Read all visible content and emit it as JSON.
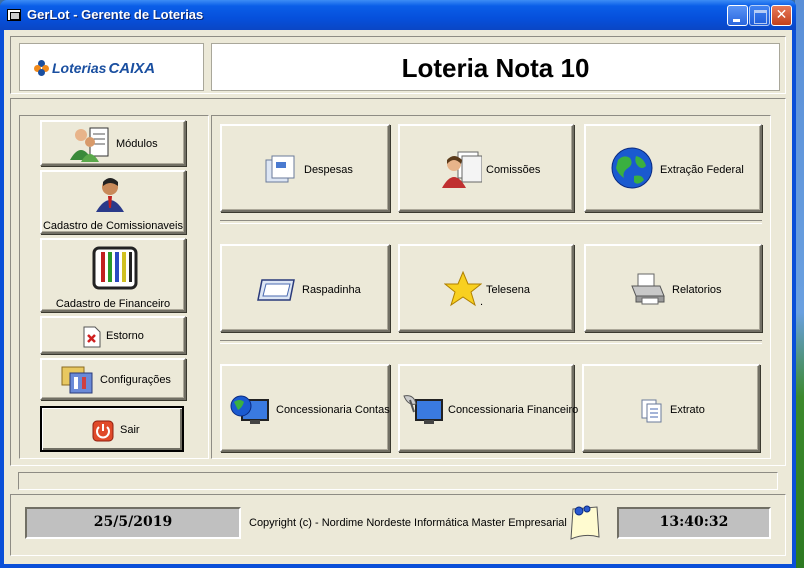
{
  "window": {
    "title": "GerLot - Gerente de Loterias",
    "close_glyph": "✕"
  },
  "header": {
    "logo_text": "Loterias",
    "logo_caixa": "CAIXA",
    "title": "Loteria Nota 10"
  },
  "sidebar": {
    "items": [
      {
        "label": "Módulos",
        "icon": "people-board-icon"
      },
      {
        "label": "Cadastro de Comissionaveis",
        "icon": "person-icon"
      },
      {
        "label": "Cadastro de Financeiro",
        "icon": "pens-icon"
      },
      {
        "label": "Estorno",
        "icon": "document-x-icon"
      },
      {
        "label": "Configurações",
        "icon": "settings-icon"
      },
      {
        "label": "Sair",
        "icon": "power-icon"
      }
    ]
  },
  "main": {
    "buttons": [
      {
        "label": "Despesas",
        "icon": "documents-icon"
      },
      {
        "label": "Comissões",
        "icon": "person-papers-icon"
      },
      {
        "label": "Extração Federal",
        "icon": "globe-icon"
      },
      {
        "label": "Raspadinha",
        "icon": "card-icon"
      },
      {
        "label": "Telesena",
        "icon": "star-icon",
        "sub": "."
      },
      {
        "label": "Relatorios",
        "icon": "printer-icon"
      },
      {
        "label": "Concessionaria Contas",
        "icon": "globe-monitor-icon"
      },
      {
        "label": "Concessionaria Financeiro",
        "icon": "satellite-monitor-icon"
      },
      {
        "label": "Extrato",
        "icon": "pages-icon"
      }
    ]
  },
  "status": {
    "date": "25/5/2019",
    "copyright": "Copyright (c) - Nordime Nordeste Informática Master Empresarial",
    "time": "13:40:32",
    "note_icon": "pinned-note-icon"
  },
  "colors": {
    "titlebar": "#0a5ee8",
    "face": "#ece9d8",
    "status_field": "#c0c0c0",
    "logo_blue": "#1a4fa0",
    "logo_orange": "#f08a1c"
  }
}
